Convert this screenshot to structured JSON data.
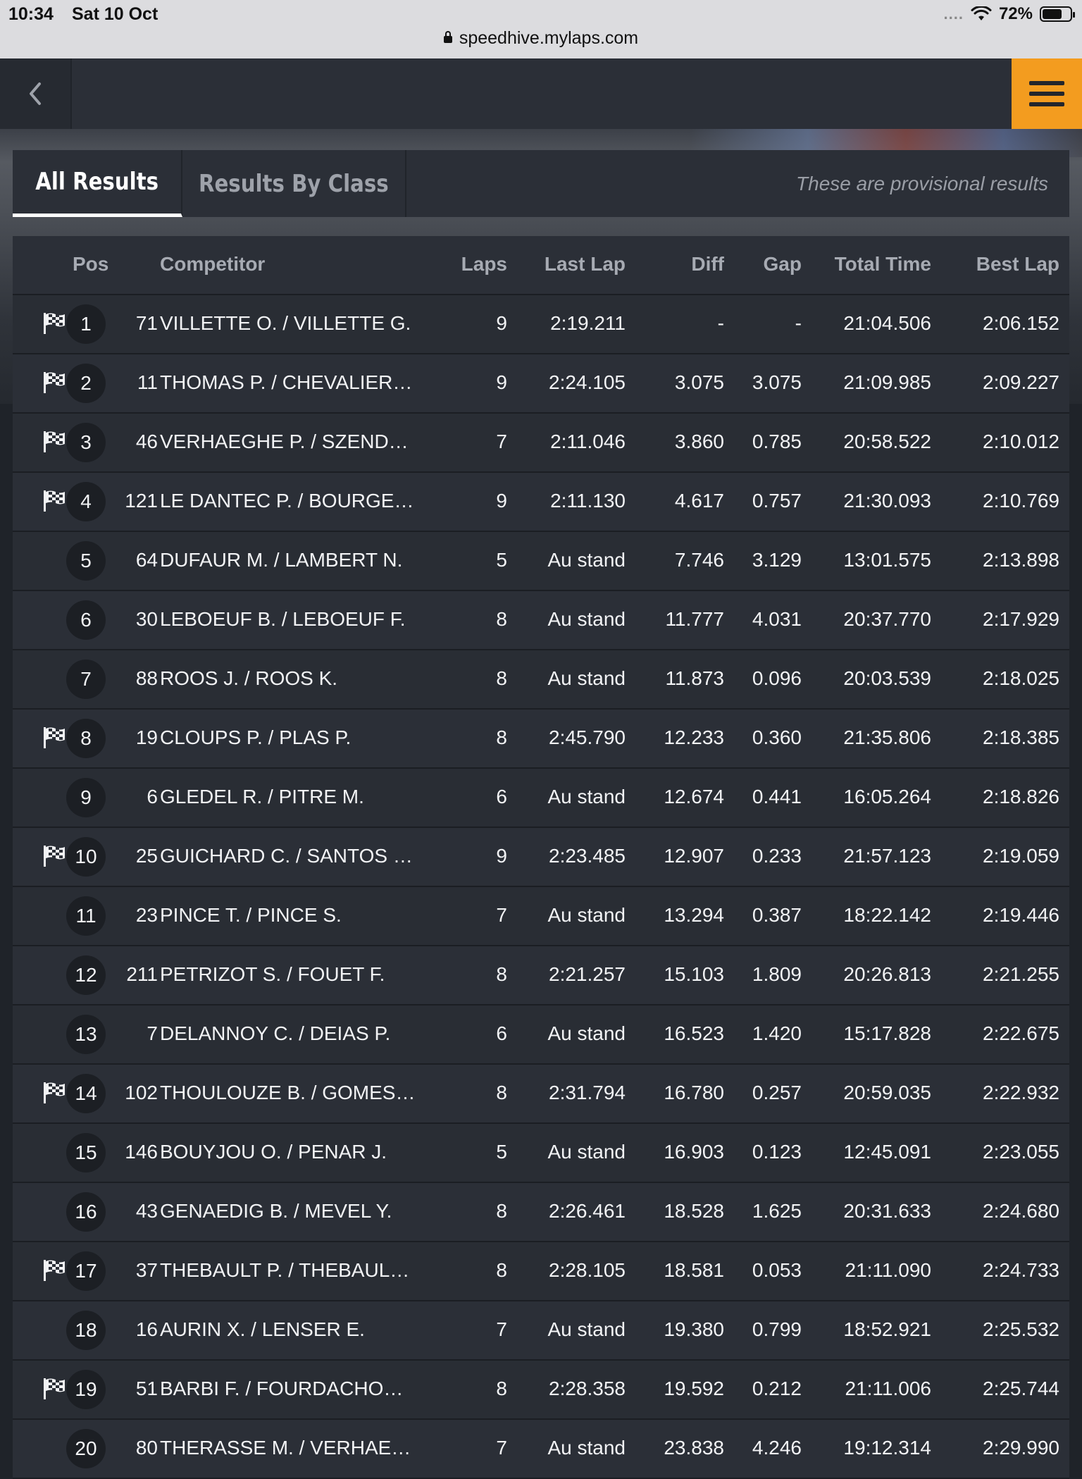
{
  "status_bar": {
    "time": "10:34",
    "date": "Sat 10 Oct",
    "signal": "....",
    "battery": "72%",
    "battery_level": 0.72
  },
  "browser": {
    "url": "speedhive.mylaps.com"
  },
  "tabs": {
    "all_results": "All Results",
    "results_by_class": "Results By Class",
    "notice": "These are provisional results"
  },
  "columns": {
    "pos": "Pos",
    "competitor": "Competitor",
    "laps": "Laps",
    "last_lap": "Last Lap",
    "diff": "Diff",
    "gap": "Gap",
    "total_time": "Total Time",
    "best_lap": "Best Lap"
  },
  "colors": {
    "accent": "#f39c1f",
    "background": "#1f2329",
    "row": "#2b2f37"
  },
  "rows": [
    {
      "pos": "1",
      "flag": true,
      "num": "71",
      "competitor": "VILLETTE O. / VILLETTE G.",
      "laps": "9",
      "last_lap": "2:19.211",
      "diff": "-",
      "gap": "-",
      "total_time": "21:04.506",
      "best_lap": "2:06.152"
    },
    {
      "pos": "2",
      "flag": true,
      "num": "11",
      "competitor": "THOMAS P. / CHEVALIER…",
      "laps": "9",
      "last_lap": "2:24.105",
      "diff": "3.075",
      "gap": "3.075",
      "total_time": "21:09.985",
      "best_lap": "2:09.227"
    },
    {
      "pos": "3",
      "flag": true,
      "num": "46",
      "competitor": "VERHAEGHE P. / SZEND…",
      "laps": "7",
      "last_lap": "2:11.046",
      "diff": "3.860",
      "gap": "0.785",
      "total_time": "20:58.522",
      "best_lap": "2:10.012"
    },
    {
      "pos": "4",
      "flag": true,
      "num": "121",
      "competitor": "LE DANTEC P. / BOURGE…",
      "laps": "9",
      "last_lap": "2:11.130",
      "diff": "4.617",
      "gap": "0.757",
      "total_time": "21:30.093",
      "best_lap": "2:10.769"
    },
    {
      "pos": "5",
      "flag": false,
      "num": "64",
      "competitor": "DUFAUR M. / LAMBERT N.",
      "laps": "5",
      "last_lap": "Au stand",
      "diff": "7.746",
      "gap": "3.129",
      "total_time": "13:01.575",
      "best_lap": "2:13.898"
    },
    {
      "pos": "6",
      "flag": false,
      "num": "30",
      "competitor": "LEBOEUF B. / LEBOEUF F.",
      "laps": "8",
      "last_lap": "Au stand",
      "diff": "11.777",
      "gap": "4.031",
      "total_time": "20:37.770",
      "best_lap": "2:17.929"
    },
    {
      "pos": "7",
      "flag": false,
      "num": "88",
      "competitor": "ROOS J. / ROOS K.",
      "laps": "8",
      "last_lap": "Au stand",
      "diff": "11.873",
      "gap": "0.096",
      "total_time": "20:03.539",
      "best_lap": "2:18.025"
    },
    {
      "pos": "8",
      "flag": true,
      "num": "19",
      "competitor": "CLOUPS P. / PLAS P.",
      "laps": "8",
      "last_lap": "2:45.790",
      "diff": "12.233",
      "gap": "0.360",
      "total_time": "21:35.806",
      "best_lap": "2:18.385"
    },
    {
      "pos": "9",
      "flag": false,
      "num": "6",
      "competitor": "GLEDEL R. / PITRE M.",
      "laps": "6",
      "last_lap": "Au stand",
      "diff": "12.674",
      "gap": "0.441",
      "total_time": "16:05.264",
      "best_lap": "2:18.826"
    },
    {
      "pos": "10",
      "flag": true,
      "num": "25",
      "competitor": "GUICHARD C. / SANTOS …",
      "laps": "9",
      "last_lap": "2:23.485",
      "diff": "12.907",
      "gap": "0.233",
      "total_time": "21:57.123",
      "best_lap": "2:19.059"
    },
    {
      "pos": "11",
      "flag": false,
      "num": "23",
      "competitor": "PINCE T. / PINCE S.",
      "laps": "7",
      "last_lap": "Au stand",
      "diff": "13.294",
      "gap": "0.387",
      "total_time": "18:22.142",
      "best_lap": "2:19.446"
    },
    {
      "pos": "12",
      "flag": false,
      "num": "211",
      "competitor": "PETRIZOT S. / FOUET F.",
      "laps": "8",
      "last_lap": "2:21.257",
      "diff": "15.103",
      "gap": "1.809",
      "total_time": "20:26.813",
      "best_lap": "2:21.255"
    },
    {
      "pos": "13",
      "flag": false,
      "num": "7",
      "competitor": "DELANNOY C. / DEIAS P.",
      "laps": "6",
      "last_lap": "Au stand",
      "diff": "16.523",
      "gap": "1.420",
      "total_time": "15:17.828",
      "best_lap": "2:22.675"
    },
    {
      "pos": "14",
      "flag": true,
      "num": "102",
      "competitor": "THOULOUZE B. / GOMES…",
      "laps": "8",
      "last_lap": "2:31.794",
      "diff": "16.780",
      "gap": "0.257",
      "total_time": "20:59.035",
      "best_lap": "2:22.932"
    },
    {
      "pos": "15",
      "flag": false,
      "num": "146",
      "competitor": "BOUYJOU O. / PENAR J.",
      "laps": "5",
      "last_lap": "Au stand",
      "diff": "16.903",
      "gap": "0.123",
      "total_time": "12:45.091",
      "best_lap": "2:23.055"
    },
    {
      "pos": "16",
      "flag": false,
      "num": "43",
      "competitor": "GENAEDIG B. / MEVEL Y.",
      "laps": "8",
      "last_lap": "2:26.461",
      "diff": "18.528",
      "gap": "1.625",
      "total_time": "20:31.633",
      "best_lap": "2:24.680"
    },
    {
      "pos": "17",
      "flag": true,
      "num": "37",
      "competitor": "THEBAULT P. / THEBAUL…",
      "laps": "8",
      "last_lap": "2:28.105",
      "diff": "18.581",
      "gap": "0.053",
      "total_time": "21:11.090",
      "best_lap": "2:24.733"
    },
    {
      "pos": "18",
      "flag": false,
      "num": "16",
      "competitor": "AURIN X. / LENSER E.",
      "laps": "7",
      "last_lap": "Au stand",
      "diff": "19.380",
      "gap": "0.799",
      "total_time": "18:52.921",
      "best_lap": "2:25.532"
    },
    {
      "pos": "19",
      "flag": true,
      "num": "51",
      "competitor": "BARBI F. / FOURDACHO…",
      "laps": "8",
      "last_lap": "2:28.358",
      "diff": "19.592",
      "gap": "0.212",
      "total_time": "21:11.006",
      "best_lap": "2:25.744"
    },
    {
      "pos": "20",
      "flag": false,
      "num": "80",
      "competitor": "THERASSE M. / VERHAE…",
      "laps": "7",
      "last_lap": "Au stand",
      "diff": "23.838",
      "gap": "4.246",
      "total_time": "19:12.314",
      "best_lap": "2:29.990"
    }
  ]
}
